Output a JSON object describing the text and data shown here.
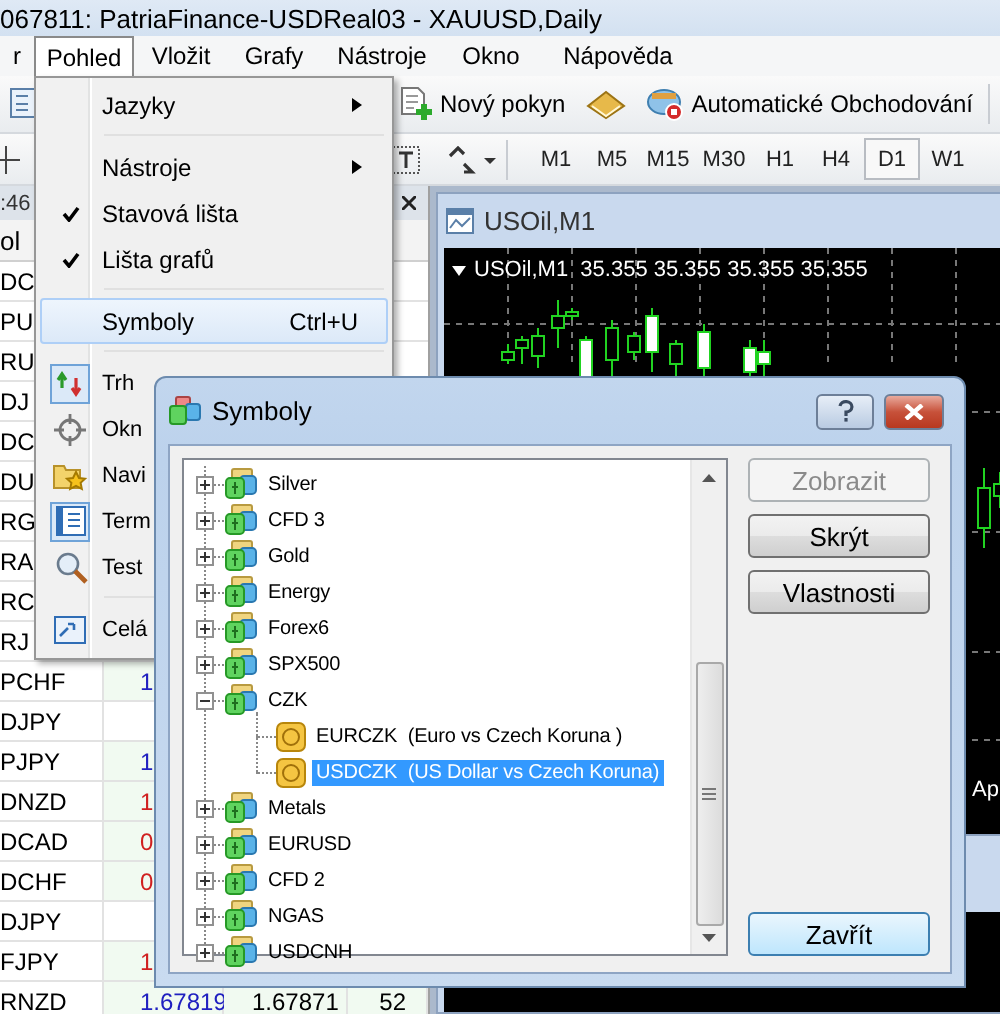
{
  "window": {
    "title": "067811: PatriaFinance-USDReal03 - XAUUSD,Daily"
  },
  "menu_bar": [
    {
      "label": "r",
      "selected": false
    },
    {
      "label": "Pohled",
      "selected": true
    },
    {
      "label": "Vložit",
      "selected": false
    },
    {
      "label": "Grafy",
      "selected": false
    },
    {
      "label": "Nástroje",
      "selected": false
    },
    {
      "label": "Okno",
      "selected": false
    },
    {
      "label": "Nápověda",
      "selected": false
    }
  ],
  "toolbar": {
    "new_order": "Nový pokyn",
    "auto_trading": "Automatické Obchodování"
  },
  "timeframes": [
    {
      "label": "M1",
      "selected": false
    },
    {
      "label": "M5",
      "selected": false
    },
    {
      "label": "M15",
      "selected": false
    },
    {
      "label": "M30",
      "selected": false
    },
    {
      "label": "H1",
      "selected": false
    },
    {
      "label": "H4",
      "selected": false
    },
    {
      "label": "D1",
      "selected": true
    },
    {
      "label": "W1",
      "selected": false
    }
  ],
  "market_watch": {
    "time": ":46",
    "column_1": "ol",
    "rows": [
      {
        "symbol": "DC"
      },
      {
        "symbol": "PU"
      },
      {
        "symbol": "RU"
      },
      {
        "symbol": "DJ"
      },
      {
        "symbol": "DC"
      },
      {
        "symbol": "DU"
      },
      {
        "symbol": "RG"
      },
      {
        "symbol": "RA"
      },
      {
        "symbol": "RC"
      },
      {
        "symbol": "RJ"
      },
      {
        "symbol": "PCHF",
        "bid": "1",
        "color": "#2020c0"
      },
      {
        "symbol": "DJPY"
      },
      {
        "symbol": "PJPY",
        "bid": "1",
        "color": "#2020c0"
      },
      {
        "symbol": "DNZD",
        "bid": "1",
        "color": "#d02020"
      },
      {
        "symbol": "DCAD",
        "bid": "0",
        "color": "#d02020"
      },
      {
        "symbol": "DCHF",
        "bid": "0",
        "color": "#d02020"
      },
      {
        "symbol": "DJPY"
      },
      {
        "symbol": "FJPY",
        "bid": "1",
        "color": "#d02020"
      },
      {
        "symbol": "RNZD",
        "bid": "1.67819",
        "ask": "1.67871",
        "spread": "52",
        "color": "#2020c0"
      }
    ]
  },
  "chart": {
    "title": "USOil,M1",
    "legend": "USOil,M1  35.355 35.355 35.355 35.355",
    "date_label": "Ap"
  },
  "view_menu": [
    {
      "kind": "submenu",
      "label": "Jazyky",
      "selected": false
    },
    {
      "kind": "separator"
    },
    {
      "kind": "submenu",
      "label": "Nástroje",
      "selected": false
    },
    {
      "kind": "check",
      "label": "Stavová lišta",
      "checked": true,
      "selected": false
    },
    {
      "kind": "check",
      "label": "Lišta grafů",
      "checked": true,
      "selected": false
    },
    {
      "kind": "separator"
    },
    {
      "kind": "command",
      "label": "Symboly",
      "shortcut": "Ctrl+U",
      "selected": true
    },
    {
      "kind": "separator"
    },
    {
      "kind": "tool",
      "label": "Trh",
      "checked": true,
      "selected": false
    },
    {
      "kind": "tool",
      "label": "Okn",
      "checked": false,
      "selected": false
    },
    {
      "kind": "tool",
      "label": "Navi",
      "checked": false,
      "selected": false
    },
    {
      "kind": "tool",
      "label": "Term",
      "checked": true,
      "selected": false
    },
    {
      "kind": "tool",
      "label": "Test",
      "checked": false,
      "selected": false
    },
    {
      "kind": "separator"
    },
    {
      "kind": "tool",
      "label": "Celá",
      "checked": false,
      "selected": false
    }
  ],
  "dialog": {
    "title": "Symboly",
    "tree": [
      {
        "label": "Silver",
        "expanded": false,
        "selected": false
      },
      {
        "label": "CFD 3",
        "expanded": false,
        "selected": false
      },
      {
        "label": "Gold",
        "expanded": false,
        "selected": false
      },
      {
        "label": "Energy",
        "expanded": false,
        "selected": false
      },
      {
        "label": "Forex6",
        "expanded": false,
        "selected": false
      },
      {
        "label": "SPX500",
        "expanded": false,
        "selected": false
      },
      {
        "label": "CZK",
        "expanded": true,
        "selected": false,
        "children": [
          {
            "label": "EURCZK  (Euro vs Czech Koruna )",
            "selected": false
          },
          {
            "label": "USDCZK  (US Dollar vs Czech Koruna)",
            "selected": true
          }
        ]
      },
      {
        "label": "Metals",
        "expanded": false,
        "selected": false
      },
      {
        "label": "EURUSD",
        "expanded": false,
        "selected": false
      },
      {
        "label": "CFD 2",
        "expanded": false,
        "selected": false
      },
      {
        "label": "NGAS",
        "expanded": false,
        "selected": false
      },
      {
        "label": "USDCNH",
        "expanded": false,
        "selected": false
      }
    ],
    "buttons": [
      {
        "label": "Zobrazit",
        "disabled": true,
        "default": false
      },
      {
        "label": "Skrýt",
        "disabled": false,
        "default": false
      },
      {
        "label": "Vlastnosti",
        "disabled": false,
        "default": false
      },
      {
        "label": "Zavřít",
        "disabled": false,
        "default": true
      }
    ]
  }
}
